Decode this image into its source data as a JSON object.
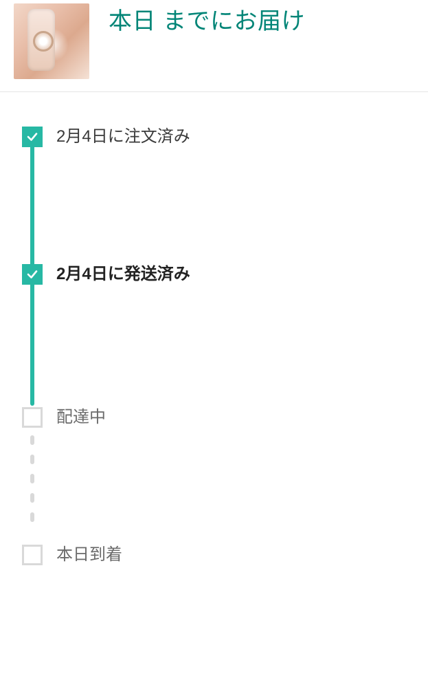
{
  "header": {
    "title": "本日 までにお届け"
  },
  "timeline": {
    "steps": [
      {
        "label": "2月4日に注文済み",
        "status": "done"
      },
      {
        "label": "2月4日に発送済み",
        "status": "current"
      },
      {
        "label": "配達中",
        "status": "pending"
      },
      {
        "label": "本日到着",
        "status": "pending"
      }
    ]
  },
  "colors": {
    "accent": "#028577",
    "progress": "#27b8a4",
    "pending": "#d9d9d9"
  }
}
